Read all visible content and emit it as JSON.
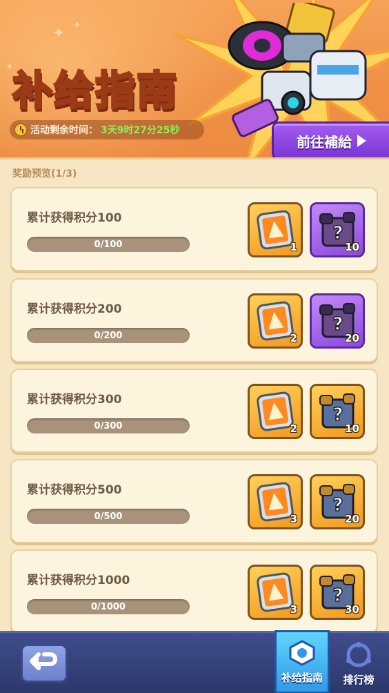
{
  "header": {
    "title": "补给指南",
    "timer_label": "活动剩余时间：",
    "timer_value": "3天9时27分25秒",
    "goto_button": "前往補給"
  },
  "list": {
    "preview_label": "奖励预览(1/3)",
    "milestones": [
      {
        "title": "累计获得积分100",
        "progress_text": "0/100",
        "progress": 0,
        "rewards": [
          {
            "icon": "orange-supply-ticket-icon",
            "count": "1"
          },
          {
            "icon": "purple-mystery-chest-icon",
            "count": "10"
          }
        ]
      },
      {
        "title": "累计获得积分200",
        "progress_text": "0/200",
        "progress": 0,
        "rewards": [
          {
            "icon": "orange-supply-ticket-icon",
            "count": "2"
          },
          {
            "icon": "purple-mystery-chest-icon",
            "count": "20"
          }
        ]
      },
      {
        "title": "累计获得积分300",
        "progress_text": "0/300",
        "progress": 0,
        "rewards": [
          {
            "icon": "orange-supply-ticket-icon",
            "count": "2"
          },
          {
            "icon": "gold-mystery-chest-icon",
            "count": "10"
          }
        ]
      },
      {
        "title": "累计获得积分500",
        "progress_text": "0/500",
        "progress": 0,
        "rewards": [
          {
            "icon": "orange-supply-ticket-icon",
            "count": "3"
          },
          {
            "icon": "gold-mystery-chest-icon",
            "count": "20"
          }
        ]
      },
      {
        "title": "累计获得积分1000",
        "progress_text": "0/1000",
        "progress": 0,
        "rewards": [
          {
            "icon": "orange-supply-ticket-icon",
            "count": "3"
          },
          {
            "icon": "gold-mystery-chest-icon",
            "count": "30"
          }
        ]
      }
    ]
  },
  "bottom_nav": {
    "tabs": [
      {
        "label": "补给指南",
        "icon": "supply-guide-icon",
        "active": true
      },
      {
        "label": "排行榜",
        "icon": "leaderboard-icon",
        "active": false
      }
    ]
  },
  "colors": {
    "header_orange": "#f08f45",
    "timer_green": "#8ef05a",
    "goto_purple": "#7b35d4",
    "active_tab_blue": "#2f9ae6"
  }
}
